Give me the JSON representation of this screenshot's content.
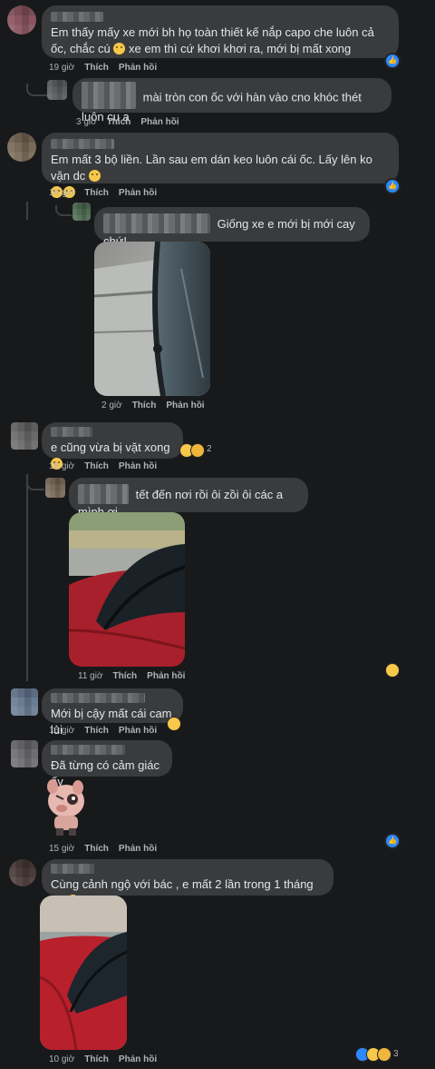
{
  "comments": [
    {
      "text": "Em thấy mấy xe mới bh họ toàn thiết kế nắp capo che luôn cả ốc, chắc cú",
      "text2": "xe em thì cứ khơi khơi ra, mới bị mất xong",
      "time": "19 giờ"
    },
    {
      "text": "mài tròn con ốc với hàn vào cno khóc thét luôn cụ ạ",
      "time": "3 giờ"
    },
    {
      "text": "Em mất 3 bộ liền. Lần sau em dán keo luôn cái ốc. Lấy lên ko vặn dc",
      "time": "19 giờ"
    },
    {
      "text": "Giống xe e mới bị mới cay chứ!",
      "time": "2 giờ"
    },
    {
      "text": "e cũng vừa bị vặt xong",
      "time": "18 giờ",
      "reaction_count": "2"
    },
    {
      "text": "tết đến nơi rồi ôi zồi ôi các a mình ơi",
      "time": "11 giờ"
    },
    {
      "text": "Mới bị cậy mất cái cam lùi",
      "time": "16 giờ"
    },
    {
      "text": "Đã từng có cảm giác ấy",
      "time": "15 giờ"
    },
    {
      "text": "Cùng cảnh ngộ với bác , e mất 2 lần trong 1 tháng rồi",
      "time": "10 giờ",
      "reaction_count": "3"
    }
  ],
  "actions": {
    "like": "Thích",
    "reply": "Phản hồi"
  },
  "colors": {
    "background": "#18191a",
    "bubble": "#3a3b3c",
    "text": "#e4e6eb",
    "meta": "#b0b3b8",
    "like": "#2d88ff"
  }
}
